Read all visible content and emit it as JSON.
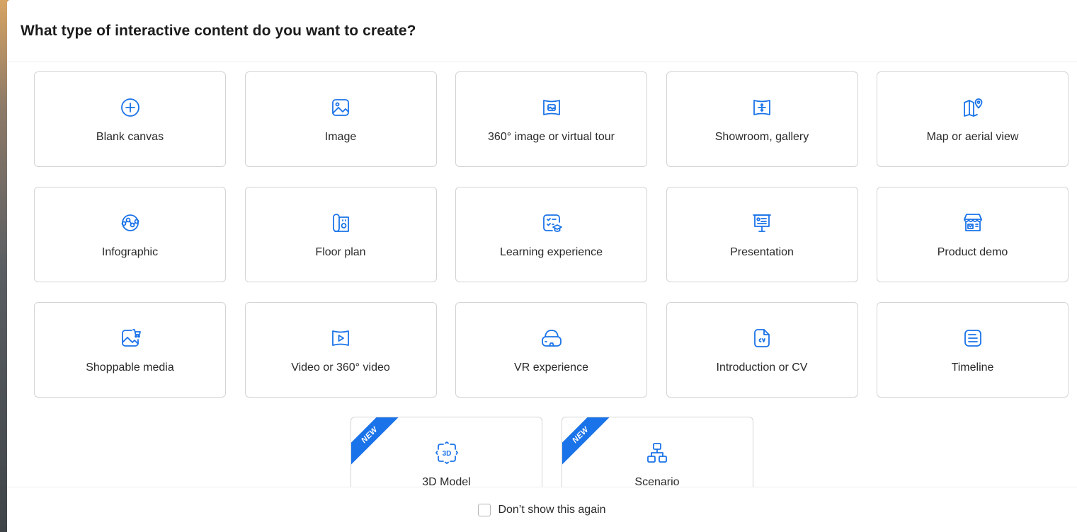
{
  "dialog": {
    "title": "What type of interactive content do you want to create?"
  },
  "content_types": [
    {
      "label": "Blank canvas",
      "icon": "plus-circle-icon"
    },
    {
      "label": "Image",
      "icon": "image-icon"
    },
    {
      "label": "360° image or virtual tour",
      "icon": "panorama-icon"
    },
    {
      "label": "Showroom, gallery",
      "icon": "showroom-icon"
    },
    {
      "label": "Map or aerial view",
      "icon": "map-pin-icon"
    },
    {
      "label": "Infographic",
      "icon": "infographic-icon"
    },
    {
      "label": "Floor plan",
      "icon": "floor-plan-icon"
    },
    {
      "label": "Learning experience",
      "icon": "learning-icon"
    },
    {
      "label": "Presentation",
      "icon": "presentation-icon"
    },
    {
      "label": "Product demo",
      "icon": "store-icon"
    },
    {
      "label": "Shoppable media",
      "icon": "shoppable-icon"
    },
    {
      "label": "Video or 360° video",
      "icon": "video-icon"
    },
    {
      "label": "VR experience",
      "icon": "vr-headset-icon"
    },
    {
      "label": "Introduction or CV",
      "icon": "cv-document-icon"
    },
    {
      "label": "Timeline",
      "icon": "timeline-icon"
    }
  ],
  "new_content_types": [
    {
      "label": "3D Model",
      "icon": "3d-icon",
      "badge": "NEW"
    },
    {
      "label": "Scenario",
      "icon": "scenario-icon",
      "badge": "NEW"
    }
  ],
  "footer": {
    "dont_show_label": "Don’t show this again",
    "checked": false
  },
  "colors": {
    "accent": "#1a73e8",
    "border": "#d4d4d4",
    "text": "#2a2a2a"
  }
}
